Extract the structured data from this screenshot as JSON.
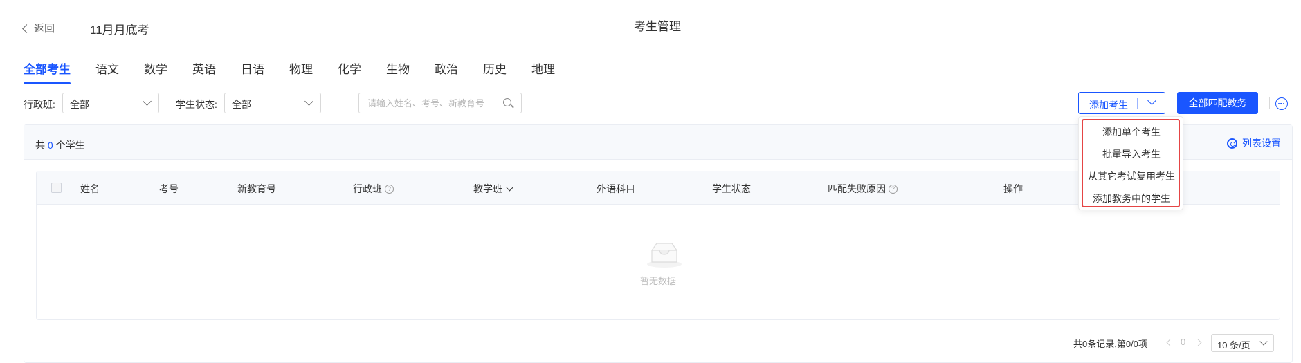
{
  "header": {
    "back_label": "返回",
    "exam_name": "11月月底考",
    "title": "考生管理"
  },
  "tabs": [
    {
      "label": "全部考生",
      "active": true
    },
    {
      "label": "语文"
    },
    {
      "label": "数学"
    },
    {
      "label": "英语"
    },
    {
      "label": "日语"
    },
    {
      "label": "物理"
    },
    {
      "label": "化学"
    },
    {
      "label": "生物"
    },
    {
      "label": "政治"
    },
    {
      "label": "历史"
    },
    {
      "label": "地理"
    }
  ],
  "filters": {
    "class_label": "行政班:",
    "class_value": "全部",
    "status_label": "学生状态:",
    "status_value": "全部",
    "search_placeholder": "请输入姓名、考号、新教育号"
  },
  "toolbar": {
    "add_label": "添加考生",
    "match_label": "全部匹配教务"
  },
  "add_menu": {
    "items": [
      "添加单个考生",
      "批量导入考生",
      "从其它考试复用考生",
      "添加教务中的学生"
    ]
  },
  "summary": {
    "prefix": "共",
    "count": "0",
    "suffix": "个学生",
    "list_settings": "列表设置"
  },
  "table": {
    "columns": [
      "姓名",
      "考号",
      "新教育号",
      "行政班",
      "教学班",
      "外语科目",
      "学生状态",
      "匹配失败原因",
      "操作"
    ],
    "empty_text": "暂无数据"
  },
  "pagination": {
    "summary": "共0条记录,第0/0项",
    "current": "0",
    "page_size": "10 条/页"
  },
  "colors": {
    "accent": "#1a56ff",
    "highlight_border": "#e54545"
  }
}
